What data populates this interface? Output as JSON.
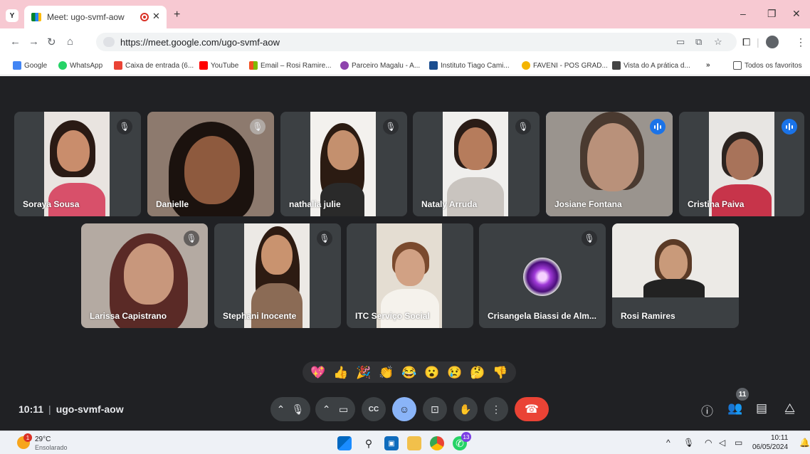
{
  "browser": {
    "tab_title": "Meet: ugo-svmf-aow",
    "tab_menu_letter": "Y",
    "url": "https://meet.google.com/ugo-svmf-aow",
    "bookmarks": [
      "Google",
      "WhatsApp",
      "Caixa de entrada (6...",
      "YouTube",
      "Email – Rosi Ramire...",
      "Parceiro Magalu - A...",
      "Instituto Tiago Cami...",
      "FAVENI - POS GRAD...",
      "Vista do A prática d..."
    ],
    "bookmarks_more": "»",
    "all_bookmarks": "Todos os favoritos",
    "colors": {
      "tabstrip": "#f7c9d2"
    }
  },
  "meet": {
    "participants": [
      {
        "name": "Soraya Sousa",
        "mic": "muted"
      },
      {
        "name": "Danielle",
        "mic": "muted"
      },
      {
        "name": "nathalia julie",
        "mic": "muted"
      },
      {
        "name": "Nataly Arruda",
        "mic": "muted"
      },
      {
        "name": "Josiane Fontana",
        "mic": "speaking"
      },
      {
        "name": "Cristina Paiva",
        "mic": "speaking"
      },
      {
        "name": "Larissa Capistrano",
        "mic": "muted"
      },
      {
        "name": "Stephani Inocente",
        "mic": "muted"
      },
      {
        "name": "ITC Serviço Social",
        "mic": "on"
      },
      {
        "name": "Crisangela Biassi de Alm...",
        "mic": "muted"
      },
      {
        "name": "Rosi Ramires",
        "mic": "on"
      }
    ],
    "reactions": [
      "💖",
      "👍",
      "🎉",
      "👏",
      "😂",
      "😮",
      "😢",
      "🤔",
      "👎"
    ],
    "time": "10:11",
    "separator": "|",
    "meeting_code": "ugo-svmf-aow",
    "participant_count": "11",
    "colors": {
      "background": "#202124",
      "tile": "#3c4043",
      "leave": "#ea4335",
      "active": "#8ab4f8"
    }
  },
  "taskbar": {
    "weather_alert": "1",
    "temperature": "29°C",
    "weather": "Ensolarado",
    "whatsapp_badge": "13",
    "time": "10:11",
    "date": "06/05/2024"
  }
}
